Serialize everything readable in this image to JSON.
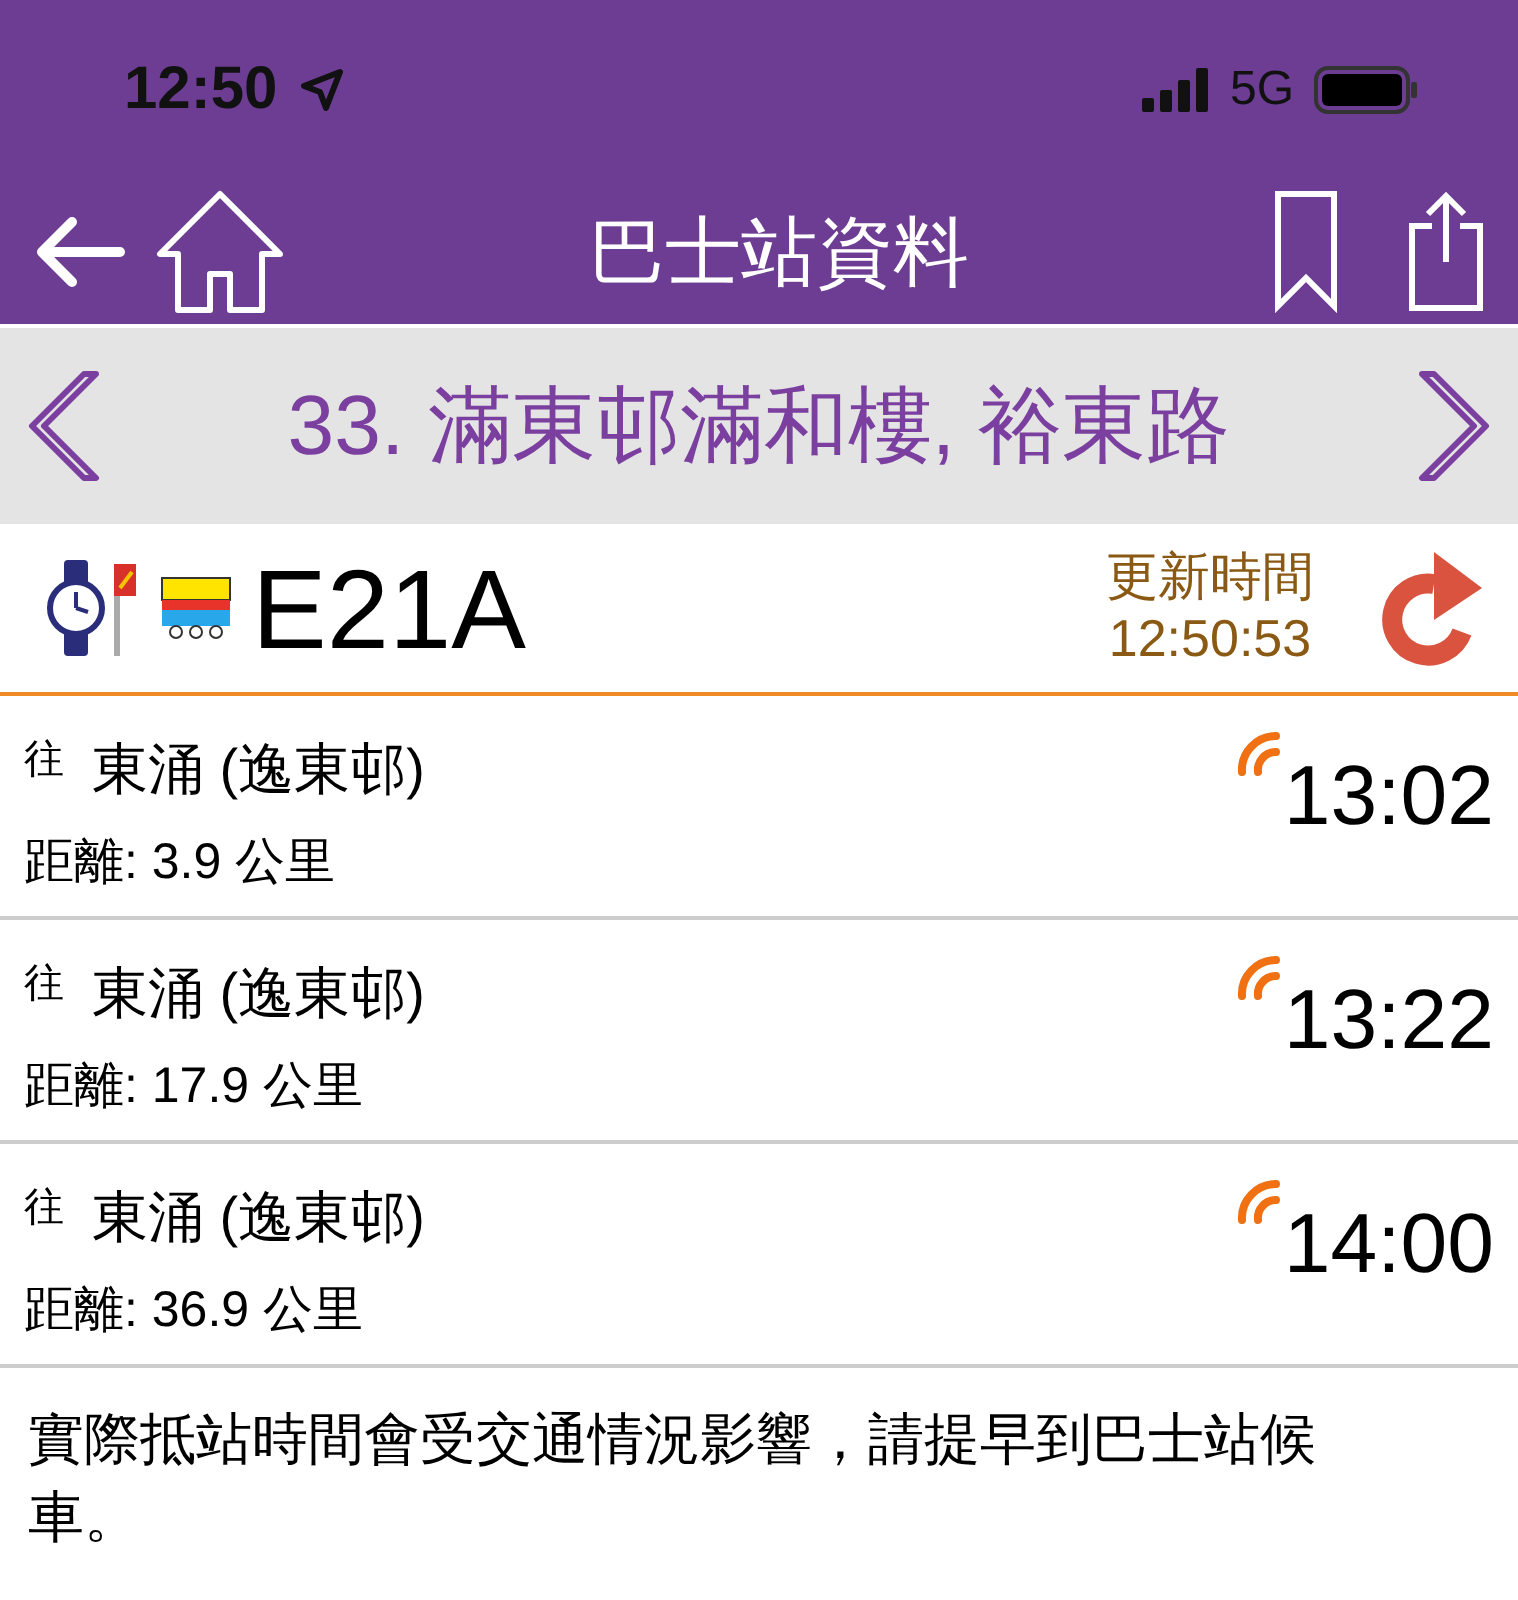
{
  "status_bar": {
    "time": "12:50",
    "network": "5G"
  },
  "nav": {
    "title": "巴士站資料"
  },
  "station": {
    "name": "33. 滿東邨滿和樓, 裕東路"
  },
  "route": {
    "number": "E21A",
    "update_label": "更新時間",
    "update_time": "12:50:53"
  },
  "arrivals": [
    {
      "prefix": "往",
      "destination": "東涌 (逸東邨)",
      "distance": "距離: 3.9 公里",
      "time": "13:02",
      "realtime": true
    },
    {
      "prefix": "往",
      "destination": "東涌 (逸東邨)",
      "distance": "距離: 17.9 公里",
      "time": "13:22",
      "realtime": true
    },
    {
      "prefix": "往",
      "destination": "東涌 (逸東邨)",
      "distance": "距離: 36.9 公里",
      "time": "14:00",
      "realtime": true
    }
  ],
  "note": "實際抵站時間會受交通情況影響，請提早到巴士站候車。"
}
